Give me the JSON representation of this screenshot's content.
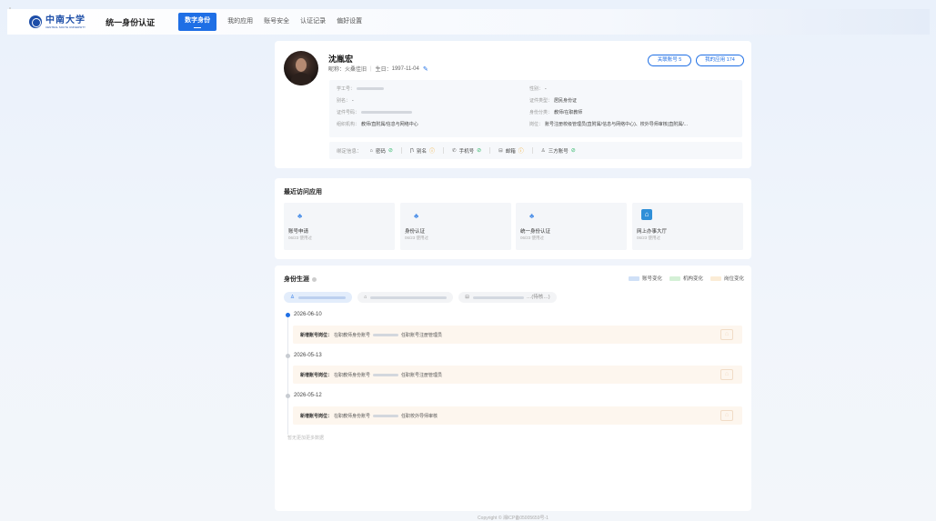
{
  "header": {
    "logo_name": "中南大学",
    "logo_sub": "CENTRAL SOUTH UNIVERSITY",
    "system_title": "统一身份认证",
    "nav": [
      "数字身份",
      "我的应用",
      "账号安全",
      "认证记录",
      "偏好设置"
    ],
    "active_nav": "数字身份"
  },
  "profile": {
    "name": "沈胤宏",
    "nickname_label": "昵称：",
    "nickname": "火桑佳旧",
    "birthday_label": "生日：",
    "birthday": "1997-11-04",
    "linked_accounts_label": "关联账号 5",
    "my_apps_label": "我的应用 174",
    "info": {
      "staff_id_label": "学工号：",
      "alias_label": "别名：",
      "alias": "-",
      "id_number_label": "证件号码：",
      "org_label": "组织机构：",
      "org": "教师/直附属/信息与网络中心",
      "gender_label": "性别：",
      "gender": "-",
      "id_type_label": "证件类型：",
      "id_type": "居民身份证",
      "identity_label": "身份分类：",
      "identity": "教师/在职教师",
      "post_label": "岗位：",
      "post": "账号注册校级管理员(直附属/信息与网络中心)、校外导师审核(直附属/..."
    },
    "bind": {
      "label": "绑定信息：",
      "items": [
        {
          "label": "密码",
          "status": "ok"
        },
        {
          "label": "别名",
          "status": "warn"
        },
        {
          "label": "手机号",
          "status": "ok"
        },
        {
          "label": "邮箱",
          "status": "warn"
        },
        {
          "label": "三方账号",
          "status": "ok"
        }
      ]
    }
  },
  "recent": {
    "title": "最近访问应用",
    "apps": [
      {
        "name": "账号申请",
        "date": "06/23 使用过"
      },
      {
        "name": "身份认证",
        "date": "06/23 使用过"
      },
      {
        "name": "统一身份认证",
        "date": "06/23 使用过"
      },
      {
        "name": "网上办事大厅",
        "date": "06/23 使用过"
      }
    ]
  },
  "career": {
    "title": "身份生涯",
    "legend": [
      {
        "label": "账号变化",
        "color": "#cfe0f7"
      },
      {
        "label": "机构变化",
        "color": "#d4f0d6"
      },
      {
        "label": "岗位变化",
        "color": "#fbecd6"
      }
    ],
    "tab_tail": "…(待核…)",
    "events": [
      {
        "date": "2026-06-10",
        "type": "新增账号岗位：",
        "prefix": "在职教师身份账号",
        "suffix": "任职账号注册管理员"
      },
      {
        "date": "2026-05-13",
        "type": "新增账号岗位：",
        "prefix": "在职教师身份账号",
        "suffix": "任职账号注册管理员"
      },
      {
        "date": "2026-05-12",
        "type": "新增账号岗位：",
        "prefix": "在职教师身份账号",
        "suffix": "任职校外导师审核"
      }
    ],
    "no_more": "暂无更加更多数据"
  },
  "footer": "Copyright © 湘ICP备05005659号-1"
}
